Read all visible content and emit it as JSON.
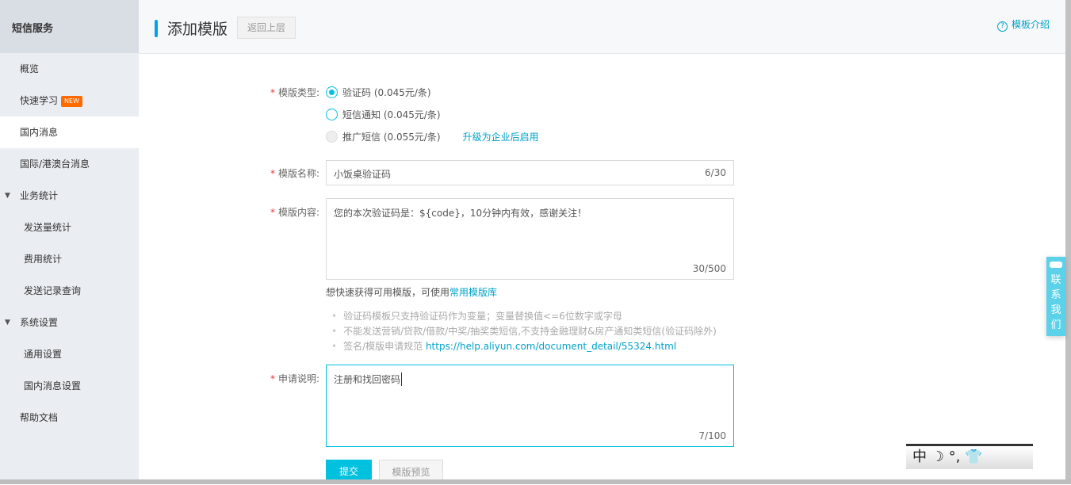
{
  "sidebar": {
    "title": "短信服务",
    "items": [
      {
        "label": "概览"
      },
      {
        "label": "快速学习",
        "badge": "NEW"
      },
      {
        "label": "国内消息"
      },
      {
        "label": "国际/港澳台消息"
      },
      {
        "label": "业务统计"
      },
      {
        "label": "发送量统计"
      },
      {
        "label": "费用统计"
      },
      {
        "label": "发送记录查询"
      },
      {
        "label": "系统设置"
      },
      {
        "label": "通用设置"
      },
      {
        "label": "国内消息设置"
      },
      {
        "label": "帮助文档"
      }
    ]
  },
  "header": {
    "title": "添加模版",
    "back_label": "返回上层",
    "intro_label": "模板介绍"
  },
  "form": {
    "type_label": "模版类型:",
    "types": [
      {
        "label": "验证码 (0.045元/条)",
        "selected": true
      },
      {
        "label": "短信通知 (0.045元/条)",
        "selected": false
      },
      {
        "label": "推广短信 (0.055元/条)",
        "disabled": true
      }
    ],
    "upgrade_link": "升级为企业后启用",
    "name_label": "模版名称:",
    "name_value": "小饭桌验证码",
    "name_count": "6/30",
    "content_label": "模版内容:",
    "content_value": "您的本次验证码是：${code}，10分钟内有效，感谢关注！",
    "content_count": "30/500",
    "hint_text": "想快速获得可用模版，可使用",
    "hint_link": "常用模版库",
    "tips": [
      "验证码模板只支持验证码作为变量；变量替换值<=6位数字或字母",
      "不能发送营销/贷款/借款/中奖/抽奖类短信,不支持金融理财&房产通知类短信(验证码除外)",
      "签名/模版申请规范"
    ],
    "tips_link": "https://help.aliyun.com/document_detail/55324.html",
    "reason_label": "申请说明:",
    "reason_value": "注册和找回密码",
    "reason_count": "7/100",
    "submit_label": "提交",
    "preview_label": "模版预览"
  },
  "contact": {
    "label": "联系我们"
  },
  "ime": {
    "label": "中"
  }
}
